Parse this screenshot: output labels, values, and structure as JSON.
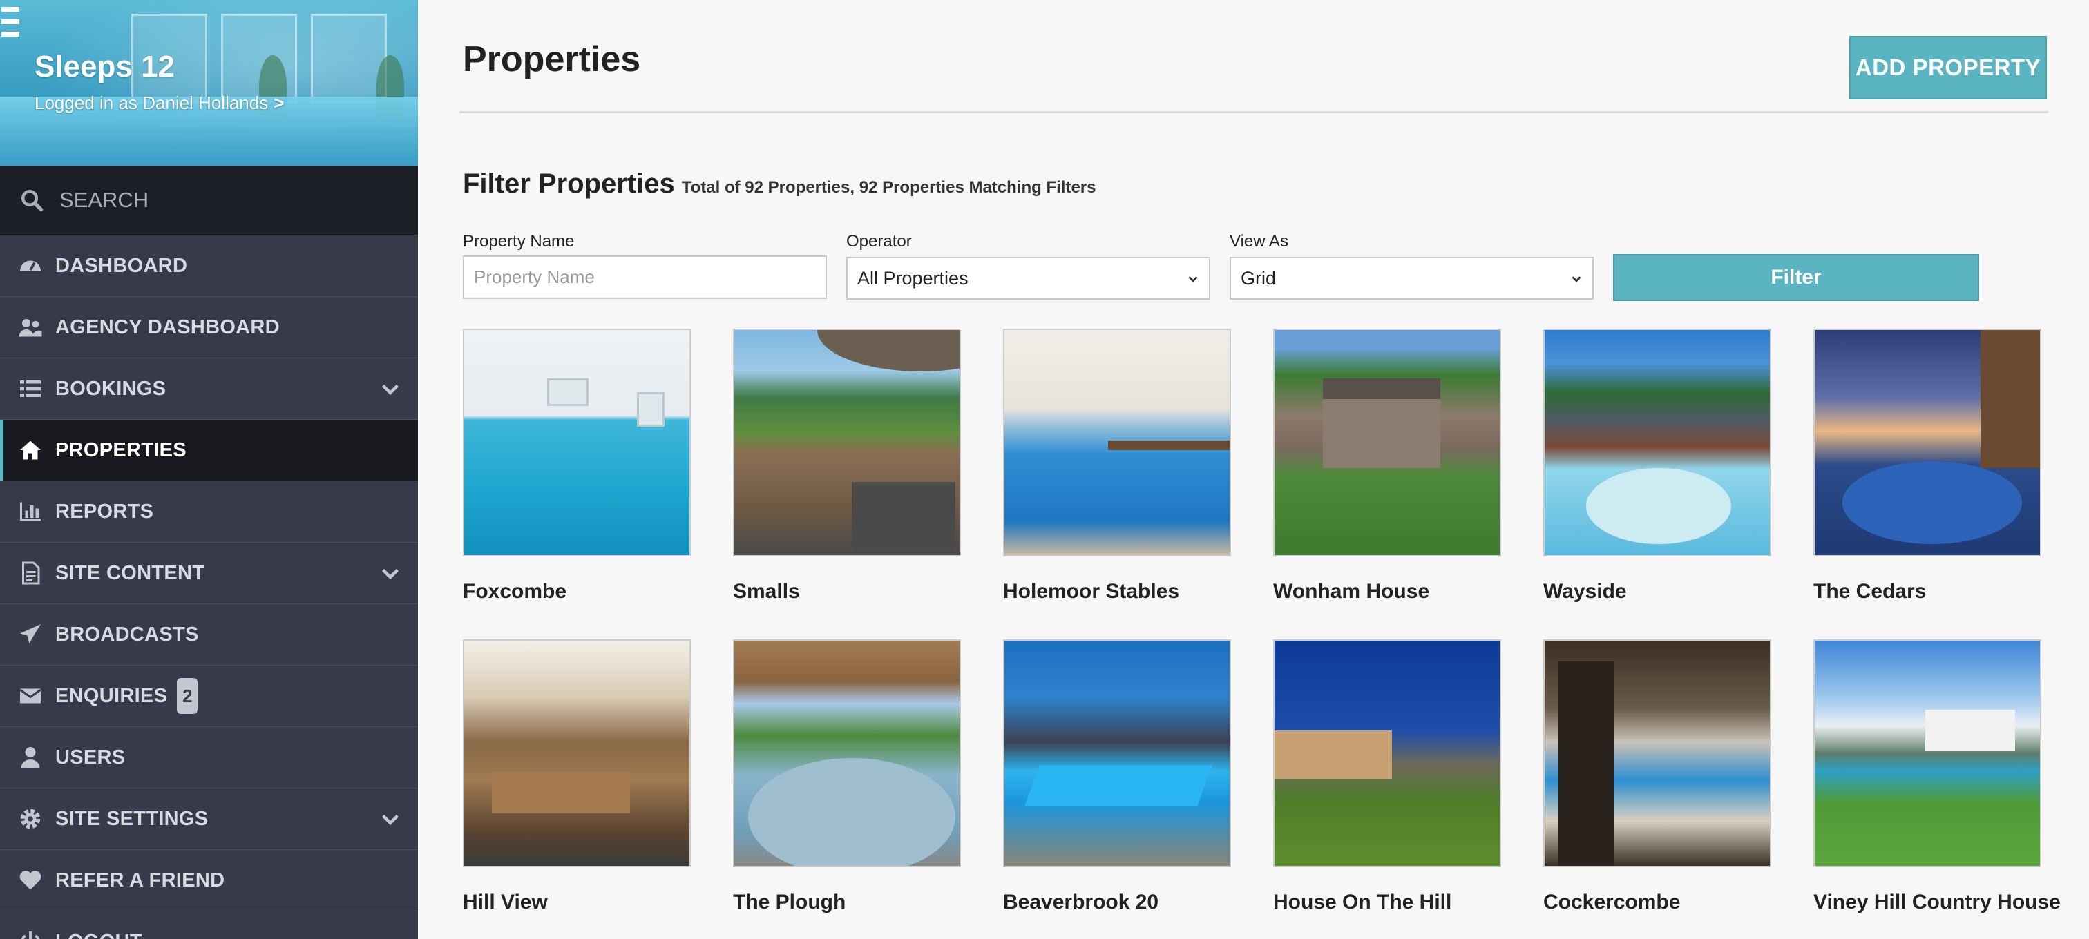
{
  "brand": {
    "title": "Sleeps 12",
    "user_text": "Logged in as Daniel Hollands",
    "user_chevron": ">"
  },
  "search": {
    "label": "SEARCH"
  },
  "nav": [
    {
      "label": "DASHBOARD",
      "icon": "dashboard-icon"
    },
    {
      "label": "AGENCY DASHBOARD",
      "icon": "users-group-icon"
    },
    {
      "label": "BOOKINGS",
      "icon": "list-icon",
      "expandable": true
    },
    {
      "label": "PROPERTIES",
      "icon": "home-icon",
      "active": true
    },
    {
      "label": "REPORTS",
      "icon": "bar-chart-icon"
    },
    {
      "label": "SITE CONTENT",
      "icon": "document-icon",
      "expandable": true
    },
    {
      "label": "BROADCASTS",
      "icon": "paper-plane-icon"
    },
    {
      "label": "ENQUIRIES",
      "icon": "envelope-icon",
      "badge": "2"
    },
    {
      "label": "USERS",
      "icon": "user-icon"
    },
    {
      "label": "SITE SETTINGS",
      "icon": "gear-icon",
      "expandable": true
    },
    {
      "label": "REFER A FRIEND",
      "icon": "heart-icon"
    },
    {
      "label": "LOGOUT",
      "icon": "power-icon"
    }
  ],
  "page": {
    "title": "Properties",
    "add_button": "ADD PROPERTY"
  },
  "filter": {
    "title": "Filter Properties",
    "summary": "Total of 92 Properties, 92 Properties Matching Filters",
    "property_name_label": "Property Name",
    "property_name_placeholder": "Property Name",
    "property_name_value": "",
    "operator_label": "Operator",
    "operator_value": "All Properties",
    "view_as_label": "View As",
    "view_as_value": "Grid",
    "button": "Filter"
  },
  "properties": [
    {
      "name": "Foxcombe"
    },
    {
      "name": "Smalls"
    },
    {
      "name": "Holemoor Stables"
    },
    {
      "name": "Wonham House"
    },
    {
      "name": "Wayside"
    },
    {
      "name": "The Cedars"
    },
    {
      "name": "Hill View"
    },
    {
      "name": "The Plough"
    },
    {
      "name": "Beaverbrook 20"
    },
    {
      "name": "House On The Hill"
    },
    {
      "name": "Cockercombe"
    },
    {
      "name": "Viney Hill Country House"
    }
  ],
  "colors": {
    "sidebar": "#363a4a",
    "sidebar_active": "#17191f",
    "accent": "#5ab4c2",
    "page_bg": "#f7f7f7"
  }
}
